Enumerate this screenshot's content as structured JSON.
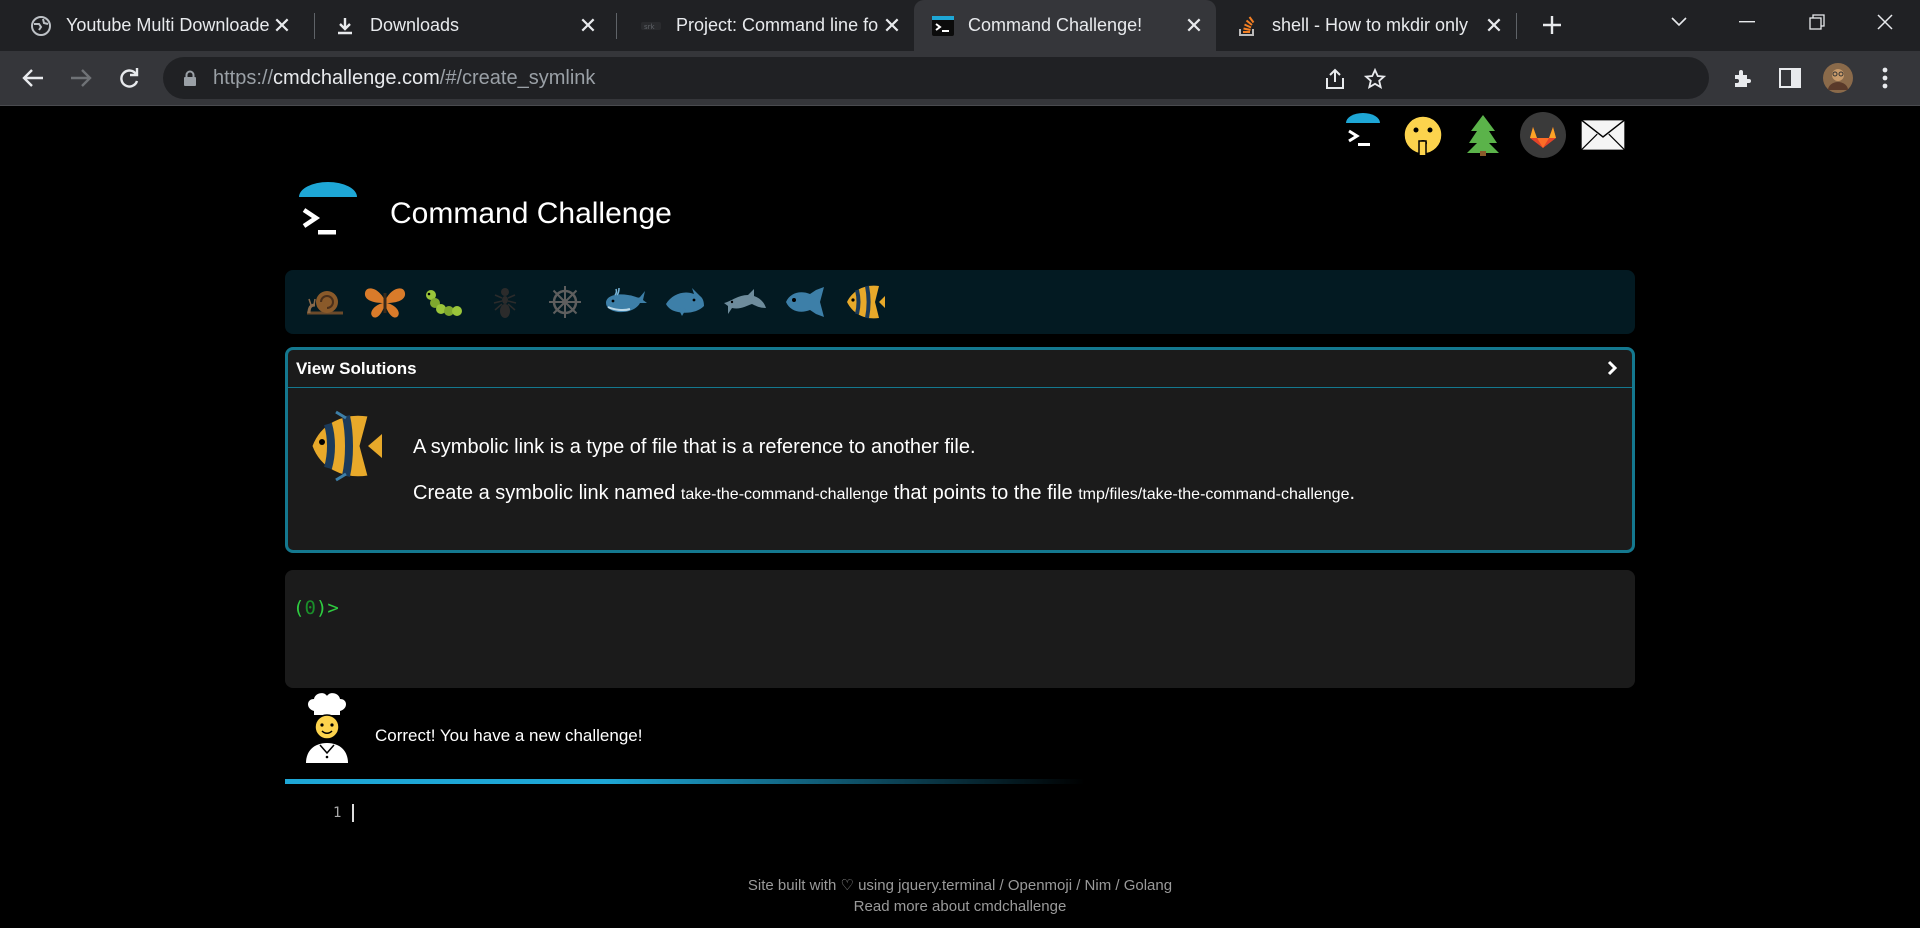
{
  "browser": {
    "tabs": [
      {
        "title": "Youtube Multi Downloade",
        "favicon": "globe-icon",
        "active": false
      },
      {
        "title": "Downloads",
        "favicon": "download-icon",
        "active": false
      },
      {
        "title": "Project: Command line fo",
        "favicon": "project-icon",
        "active": false
      },
      {
        "title": "Command Challenge!",
        "favicon": "terminal-icon",
        "active": true
      },
      {
        "title": "shell - How to mkdir only",
        "favicon": "stackoverflow-icon",
        "active": false
      }
    ],
    "url_scheme": "https://",
    "url_host": "cmdchallenge.com",
    "url_path": "/#/create_symlink"
  },
  "page": {
    "site_title": "Command Challenge",
    "levels": [
      {
        "icon": "snail-icon",
        "color": "#6b4a2a"
      },
      {
        "icon": "butterfly-icon",
        "color": "#c8682a"
      },
      {
        "icon": "caterpillar-icon",
        "color": "#7fa82e"
      },
      {
        "icon": "ant-icon",
        "color": "#3a3a3a"
      },
      {
        "icon": "ship-wheel-icon",
        "color": "#5a5a5a"
      },
      {
        "icon": "whale-icon",
        "color": "#3d7fa8"
      },
      {
        "icon": "shark-icon",
        "color": "#3d7fa8"
      },
      {
        "icon": "dolphin-icon",
        "color": "#6e8c9c"
      },
      {
        "icon": "fish-icon",
        "color": "#3d7fa8"
      },
      {
        "icon": "tropical-fish-icon",
        "color": "#e8a92a"
      }
    ],
    "challenge": {
      "header": "View Solutions",
      "line1": "A symbolic link is a type of file that is a reference to another file.",
      "line2_a": "Create a symbolic link named ",
      "line2_link": "take-the-command-challenge",
      "line2_b": " that points to the file ",
      "line2_target": "tmp/files/take-the-command-challenge",
      "line2_end": "."
    },
    "terminal": {
      "prompt_open": "(",
      "prompt_num": "0",
      "prompt_close": ")>"
    },
    "feedback": "Correct! You have a new challenge!",
    "line_number": "1",
    "footer_line1": "Site built with ♡ using jquery.terminal / Openmoji / Nim / Golang",
    "footer_line2": "Read more about cmdchallenge"
  }
}
